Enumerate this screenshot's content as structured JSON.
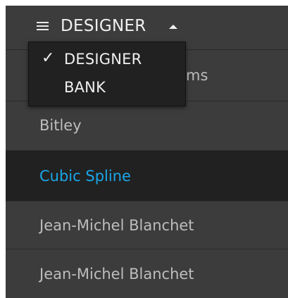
{
  "header": {
    "title": "DESIGNER",
    "menu_icon": "hamburger-icon",
    "caret_icon": "caret-up-icon"
  },
  "dropdown": {
    "items": [
      {
        "label": "DESIGNER",
        "checked": true,
        "check_glyph": "✓"
      },
      {
        "label": "BANK",
        "checked": false,
        "check_glyph": ""
      }
    ]
  },
  "list": {
    "items": [
      {
        "label": "ms",
        "selected": false
      },
      {
        "label": "Bitley",
        "selected": false
      },
      {
        "label": "Cubic Spline",
        "selected": true
      },
      {
        "label": "Jean-Michel Blanchet",
        "selected": false
      },
      {
        "label": "Jean-Michel Blanchet",
        "selected": false
      }
    ]
  },
  "colors": {
    "panel_bg": "#3c3c3c",
    "selected_bg": "#212121",
    "accent": "#1aa6e8",
    "text_muted": "#bdbdbd",
    "text_light": "#f0f0f0"
  }
}
